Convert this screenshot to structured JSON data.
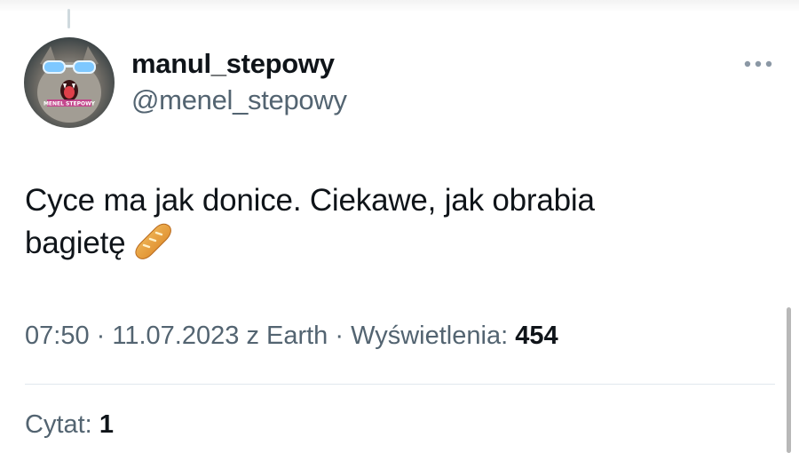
{
  "tweet": {
    "author": {
      "display_name": "manul_stepowy",
      "handle": "@menel_stepowy",
      "avatar_text": "MENEL STEPOWY"
    },
    "text_line1": "Cyce ma jak donice. Ciekawe, jak obrabia",
    "text_line2": "bagietę",
    "emoji": "baguette-bread",
    "time": "07:50",
    "separator": "·",
    "date": "11.07.2023",
    "source": "z Earth",
    "views_label": "Wyświetlenia:",
    "views_count": "454",
    "quotes_label": "Cytat:",
    "quotes_count": "1"
  },
  "icons": {
    "more": "more-horizontal-icon"
  },
  "colors": {
    "text_primary": "#0f1419",
    "text_secondary": "#536471",
    "divider": "#e1e8ed",
    "more_icon": "#8b98a5"
  }
}
